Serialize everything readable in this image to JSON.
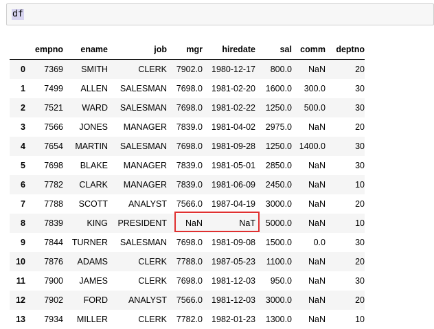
{
  "input_cell": {
    "code": "df"
  },
  "table": {
    "columns": [
      "",
      "empno",
      "ename",
      "job",
      "mgr",
      "hiredate",
      "sal",
      "comm",
      "deptno"
    ],
    "rows": [
      [
        "0",
        "7369",
        "SMITH",
        "CLERK",
        "7902.0",
        "1980-12-17",
        "800.0",
        "NaN",
        "20"
      ],
      [
        "1",
        "7499",
        "ALLEN",
        "SALESMAN",
        "7698.0",
        "1981-02-20",
        "1600.0",
        "300.0",
        "30"
      ],
      [
        "2",
        "7521",
        "WARD",
        "SALESMAN",
        "7698.0",
        "1981-02-22",
        "1250.0",
        "500.0",
        "30"
      ],
      [
        "3",
        "7566",
        "JONES",
        "MANAGER",
        "7839.0",
        "1981-04-02",
        "2975.0",
        "NaN",
        "20"
      ],
      [
        "4",
        "7654",
        "MARTIN",
        "SALESMAN",
        "7698.0",
        "1981-09-28",
        "1250.0",
        "1400.0",
        "30"
      ],
      [
        "5",
        "7698",
        "BLAKE",
        "MANAGER",
        "7839.0",
        "1981-05-01",
        "2850.0",
        "NaN",
        "30"
      ],
      [
        "6",
        "7782",
        "CLARK",
        "MANAGER",
        "7839.0",
        "1981-06-09",
        "2450.0",
        "NaN",
        "10"
      ],
      [
        "7",
        "7788",
        "SCOTT",
        "ANALYST",
        "7566.0",
        "1987-04-19",
        "3000.0",
        "NaN",
        "20"
      ],
      [
        "8",
        "7839",
        "KING",
        "PRESIDENT",
        "NaN",
        "NaT",
        "5000.0",
        "NaN",
        "10"
      ],
      [
        "9",
        "7844",
        "TURNER",
        "SALESMAN",
        "7698.0",
        "1981-09-08",
        "1500.0",
        "0.0",
        "30"
      ],
      [
        "10",
        "7876",
        "ADAMS",
        "CLERK",
        "7788.0",
        "1987-05-23",
        "1100.0",
        "NaN",
        "20"
      ],
      [
        "11",
        "7900",
        "JAMES",
        "CLERK",
        "7698.0",
        "1981-12-03",
        "950.0",
        "NaN",
        "30"
      ],
      [
        "12",
        "7902",
        "FORD",
        "ANALYST",
        "7566.0",
        "1981-12-03",
        "3000.0",
        "NaN",
        "20"
      ],
      [
        "13",
        "7934",
        "MILLER",
        "CLERK",
        "7782.0",
        "1982-01-23",
        "1300.0",
        "NaN",
        "10"
      ]
    ]
  },
  "highlight_color": "#e03030"
}
